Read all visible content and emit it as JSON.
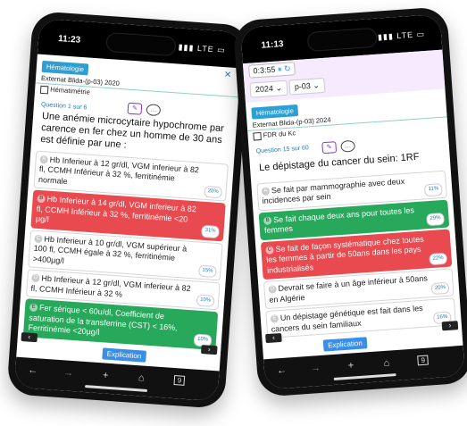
{
  "left_phone": {
    "status": {
      "time": "11:23",
      "signal": "LTE"
    },
    "tag": "Hématologie",
    "close_symbol": "×",
    "exam": "Externat Blida-(p-03) 2020",
    "topic": "Hématimétrie",
    "question_number": "Question 1 sur 6",
    "question": "Une anémie microcytaire hypochrome par carence en fer chez un homme de 30 ans est définie par une :",
    "options": [
      {
        "letter": "A",
        "text": "Hb Inferieur à 12 gr/dl, VGM inferieur à 82 fl, CCMH Inférieur à 32 %, ferritinémie normale",
        "pct": "20%",
        "state": "normal"
      },
      {
        "letter": "B",
        "text": "Hb Inferieur à 14 gr/dl, VGM inferieur à 82 fl, CCMH Inférieur à 32 %, ferritinémie <20 µg/l",
        "pct": "31%",
        "state": "wrong"
      },
      {
        "letter": "C",
        "text": "Hb Inferieur à 10 gr/dl, VGM supérieur à 100 fl, CCMH égale à 32 %, ferritinémie >400µg/l",
        "pct": "15%",
        "state": "normal"
      },
      {
        "letter": "D",
        "text": "Hb Inferieur à 12 gr/dl, VGM inferieur à 82 fl, CCMH Inférieur à 32 %",
        "pct": "10%",
        "state": "normal"
      },
      {
        "letter": "E",
        "text": "Fer sérique < 60u/dl, Coefficient de saturation de la transferrine (CST) < 16%, Ferritinémie <20µg/l",
        "pct": "10%",
        "state": "correct"
      }
    ],
    "explication_label": "Explication",
    "bottom": {
      "back": "←",
      "forward": "→",
      "plus": "+",
      "home": "⌂",
      "tabs": "9"
    }
  },
  "right_phone": {
    "status": {
      "time": "11:13",
      "signal": "LTE"
    },
    "timer": "0:3:55",
    "year_select": "2024",
    "period_select": "p-03",
    "tag": "Hématologie",
    "exam": "Externat Blida-(p-03) 2024",
    "topic": "FDR du Kc",
    "question_number": "Question 15 sur 60",
    "question": "Le dépistage du cancer du sein: 1RF",
    "options": [
      {
        "letter": "A",
        "text": "Se fait par mammographie avec deux incidences par sein",
        "pct": "11%",
        "state": "normal"
      },
      {
        "letter": "B",
        "text": "Se fait chaque deux ans pour toutes les femmes",
        "pct": "29%",
        "state": "correct"
      },
      {
        "letter": "C",
        "text": "Se fait de façon systématique chez toutes les femmes à partir de 50ans dans les pays industrialisés",
        "pct": "22%",
        "state": "wrong"
      },
      {
        "letter": "D",
        "text": "Devrait se faire à un âge inférieur à 50ans en Algérie",
        "pct": "20%",
        "state": "normal"
      },
      {
        "letter": "E",
        "text": "Un dépistage génétique est fait dans les cancers du sein familiaux",
        "pct": "16%",
        "state": "normal"
      }
    ],
    "explication_label": "Explication",
    "bottom": {
      "back": "←",
      "forward": "→",
      "plus": "+",
      "home": "⌂",
      "tabs": "9"
    }
  }
}
